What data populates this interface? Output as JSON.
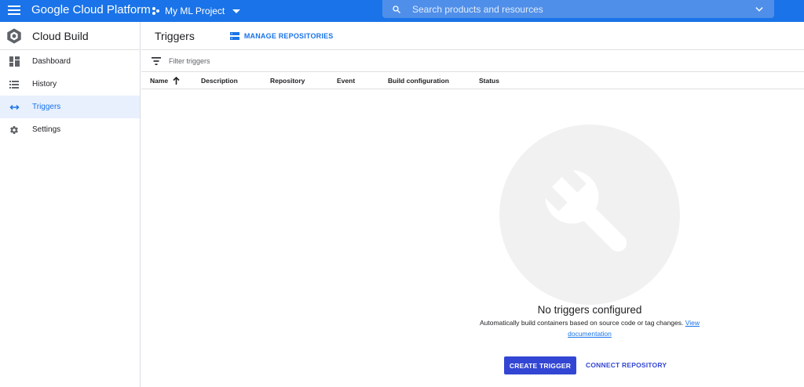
{
  "topbar": {
    "brand": "Google Cloud Platform",
    "project_name": "My ML Project",
    "search_placeholder": "Search products and resources",
    "color": "#1a73e8"
  },
  "sidebar": {
    "product_title": "Cloud Build",
    "items": [
      {
        "label": "Dashboard",
        "icon": "dashboard-icon",
        "active": false
      },
      {
        "label": "History",
        "icon": "list-icon",
        "active": false
      },
      {
        "label": "Triggers",
        "icon": "trigger-arrows-icon",
        "active": true
      },
      {
        "label": "Settings",
        "icon": "gear-icon",
        "active": false
      }
    ]
  },
  "main": {
    "title": "Triggers",
    "manage_repositories": "MANAGE REPOSITORIES",
    "filter_placeholder": "Filter triggers",
    "columns": [
      "Name",
      "Description",
      "Repository",
      "Event",
      "Build configuration",
      "Status"
    ],
    "sort_column": "Name",
    "sort_direction": "ascending"
  },
  "empty_state": {
    "icon": "wrench-icon",
    "title": "No triggers configured",
    "description": "Automatically build containers based on source code or tag changes.",
    "link": "View documentation",
    "primary_button": "CREATE TRIGGER",
    "secondary_button": "CONNECT REPOSITORY",
    "accent_color": "#3346d3"
  }
}
